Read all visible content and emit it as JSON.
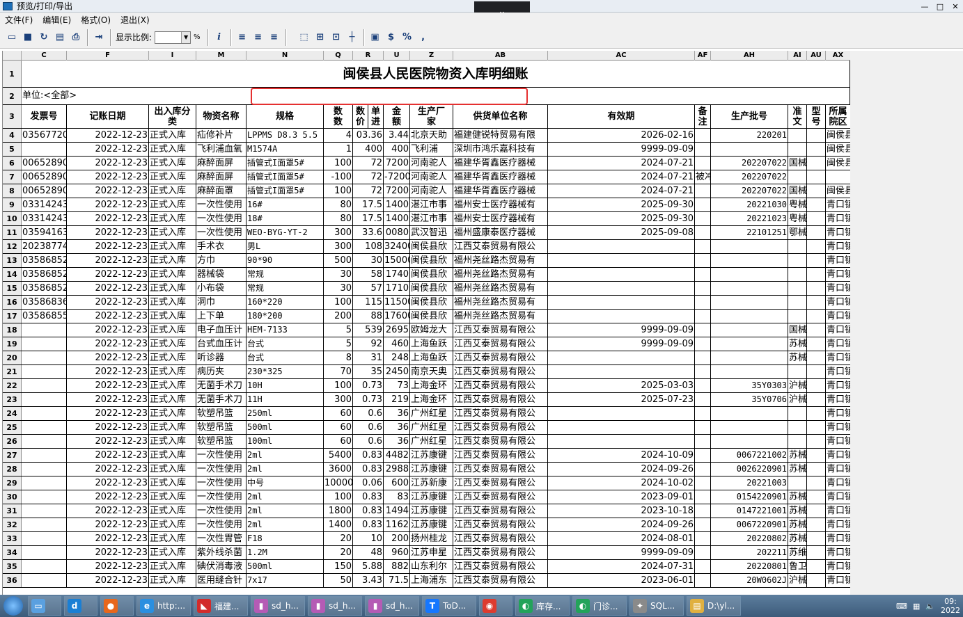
{
  "window": {
    "title": "预览/打印/导出",
    "controls": [
      "—",
      "□",
      "✕"
    ],
    "drop_icon": "chevron-down-icon"
  },
  "menu": [
    "文件(F)",
    "编辑(E)",
    "格式(O)",
    "退出(X)"
  ],
  "toolbar": {
    "zoom_label": "显示比例:",
    "zoom_value": "",
    "zoom_unit": "%",
    "icons": [
      "open-icon",
      "save-icon",
      "refresh-icon",
      "print-preview-icon",
      "print-icon",
      "export-icon",
      "info-icon",
      "align-left-icon",
      "align-center-icon",
      "align-right-icon",
      "grid-a-icon",
      "grid-b-icon",
      "grid-c-icon",
      "grid-d-icon",
      "format-icon",
      "currency-icon",
      "percent-icon",
      "thousands-icon"
    ]
  },
  "sheet": {
    "columns": [
      "C",
      "F",
      "I",
      "M",
      "N",
      "Q",
      "R",
      "U",
      "Z",
      "AB",
      "AC",
      "AF",
      "AH",
      "AI",
      "AU",
      "AX"
    ],
    "title": "闽侯县人民医院物资入库明细账",
    "unit": "单位:<全部>",
    "headers": [
      "发票号",
      "记账日期",
      "出入库分类",
      "物资名称",
      "规格",
      "数量",
      "数价",
      "单进",
      "金额",
      "生产厂家",
      "供货单位名称",
      "有效期",
      "备注",
      "生产批号",
      "准文",
      "型号",
      "所属院区"
    ],
    "header_lines": [
      [
        "发票号"
      ],
      [
        "记账日期"
      ],
      [
        "出入库分",
        "类"
      ],
      [
        "物资名称"
      ],
      [
        "规格"
      ],
      [
        "数",
        "数"
      ],
      [
        "数",
        "价"
      ],
      [
        "单",
        "进"
      ],
      [
        "金",
        "额"
      ],
      [
        "生产厂",
        "家"
      ],
      [
        "供货单位名称"
      ],
      [
        "有效期"
      ],
      [
        "备",
        "注"
      ],
      [
        "生产批号"
      ],
      [
        "准",
        "文"
      ],
      [
        "型",
        "号"
      ],
      [
        "所属",
        "院区"
      ]
    ],
    "rows": [
      [
        "03567720",
        "2022-12-23",
        "正式入库",
        "疝修补片",
        "LPPMS D8.3 5.5",
        "4",
        "03.36",
        "3.44",
        "北京天助",
        "福建健锐特贸易有限",
        "2026-02-16",
        "",
        "220201",
        "",
        "",
        "闽侯县"
      ],
      [
        "",
        "2022-12-23",
        "正式入库",
        "飞利浦血氧",
        "M1574A",
        "1",
        "400",
        "400",
        "飞利浦",
        "深圳市鸿乐嘉科技有",
        "9999-09-09",
        "",
        "",
        "",
        "",
        "闽侯县"
      ],
      [
        "00652890",
        "2022-12-23",
        "正式入库",
        "麻醉面屏",
        "插管式I面罩5#",
        "100",
        "72",
        "7200",
        "河南驼人",
        "福建华胥鑫医疗器械",
        "2024-07-21",
        "",
        "202207022",
        "国械",
        "",
        "闽侯县"
      ],
      [
        "00652890",
        "2022-12-23",
        "正式入库",
        "麻醉面屏",
        "插管式I面罩5#",
        "-100",
        "72",
        "-7200",
        "河南驼人",
        "福建华胥鑫医疗器械",
        "2024-07-21",
        "被冲",
        "202207022",
        "",
        "",
        ""
      ],
      [
        "00652890",
        "2022-12-23",
        "正式入库",
        "麻醉面罩",
        "插管式I面罩5#",
        "100",
        "72",
        "7200",
        "河南驼人",
        "福建华胥鑫医疗器械",
        "2024-07-21",
        "",
        "202207022",
        "国械",
        "",
        "闽侯县"
      ],
      [
        "03314243",
        "2022-12-23",
        "正式入库",
        "一次性使用",
        "16#",
        "80",
        "17.5",
        "1400",
        "湛江市事",
        "福州安士医疗器械有",
        "2025-09-30",
        "",
        "20221030",
        "粤械",
        "",
        "青口镇"
      ],
      [
        "03314243",
        "2022-12-23",
        "正式入库",
        "一次性使用",
        "18#",
        "80",
        "17.5",
        "1400",
        "湛江市事",
        "福州安士医疗器械有",
        "2025-09-30",
        "",
        "20221023",
        "粤械",
        "",
        "青口镇"
      ],
      [
        "03594163",
        "2022-12-23",
        "正式入库",
        "一次性使用",
        "WEO-BYG-YT-2",
        "300",
        "33.6",
        "0080",
        "武汉智迅",
        "福州盛康泰医疗器械",
        "2025-09-08",
        "",
        "22101251",
        "鄂械",
        "",
        "青口镇"
      ],
      [
        "20238774",
        "2022-12-23",
        "正式入库",
        "手术衣",
        "男L",
        "300",
        "108",
        "32400",
        "闽侯县欣",
        "江西艾泰贸易有限公",
        "",
        "",
        "",
        "",
        "",
        "青口镇"
      ],
      [
        "03586852",
        "2022-12-23",
        "正式入库",
        "方巾",
        "90*90",
        "500",
        "30",
        "15000",
        "闽侯县欣",
        "福州尧丝路杰贸易有",
        "",
        "",
        "",
        "",
        "",
        "青口镇"
      ],
      [
        "03586852",
        "2022-12-23",
        "正式入库",
        "器械袋",
        "常规",
        "30",
        "58",
        "1740",
        "闽侯县欣",
        "福州尧丝路杰贸易有",
        "",
        "",
        "",
        "",
        "",
        "青口镇"
      ],
      [
        "03586852",
        "2022-12-23",
        "正式入库",
        "小布袋",
        "常规",
        "30",
        "57",
        "1710",
        "闽侯县欣",
        "福州尧丝路杰贸易有",
        "",
        "",
        "",
        "",
        "",
        "青口镇"
      ],
      [
        "03586836",
        "2022-12-23",
        "正式入库",
        "洞巾",
        "160*220",
        "100",
        "115",
        "11500",
        "闽侯县欣",
        "福州尧丝路杰贸易有",
        "",
        "",
        "",
        "",
        "",
        "青口镇"
      ],
      [
        "03586855",
        "2022-12-23",
        "正式入库",
        "上下单",
        "180*200",
        "200",
        "88",
        "17600",
        "闽侯县欣",
        "福州尧丝路杰贸易有",
        "",
        "",
        "",
        "",
        "",
        "青口镇"
      ],
      [
        "",
        "2022-12-23",
        "正式入库",
        "电子血压计",
        "HEM-7133",
        "5",
        "539",
        "2695",
        "欧姆龙大",
        "江西艾泰贸易有限公",
        "9999-09-09",
        "",
        "",
        "国械",
        "",
        "青口镇"
      ],
      [
        "",
        "2022-12-23",
        "正式入库",
        "台式血压计",
        "台式",
        "5",
        "92",
        "460",
        "上海鱼跃",
        "江西艾泰贸易有限公",
        "9999-09-09",
        "",
        "",
        "苏械",
        "",
        "青口镇"
      ],
      [
        "",
        "2022-12-23",
        "正式入库",
        "听诊器",
        "台式",
        "8",
        "31",
        "248",
        "上海鱼跃",
        "江西艾泰贸易有限公",
        "",
        "",
        "",
        "苏械",
        "",
        "青口镇"
      ],
      [
        "",
        "2022-12-23",
        "正式入库",
        "病历夹",
        "230*325",
        "70",
        "35",
        "2450",
        "南京天奥",
        "江西艾泰贸易有限公",
        "",
        "",
        "",
        "",
        "",
        "青口镇"
      ],
      [
        "",
        "2022-12-23",
        "正式入库",
        "无菌手术刀",
        "10H",
        "100",
        "0.73",
        "73",
        "上海金环",
        "江西艾泰贸易有限公",
        "2025-03-03",
        "",
        "35Y0303",
        "沪械",
        "",
        "青口镇"
      ],
      [
        "",
        "2022-12-23",
        "正式入库",
        "无菌手术刀",
        "11H",
        "300",
        "0.73",
        "219",
        "上海金环",
        "江西艾泰贸易有限公",
        "2025-07-23",
        "",
        "35Y0706",
        "沪械",
        "",
        "青口镇"
      ],
      [
        "",
        "2022-12-23",
        "正式入库",
        "软塑吊篮",
        "250ml",
        "60",
        "0.6",
        "36",
        "广州红星",
        "江西艾泰贸易有限公",
        "",
        "",
        "",
        "",
        "",
        "青口镇"
      ],
      [
        "",
        "2022-12-23",
        "正式入库",
        "软塑吊篮",
        "500ml",
        "60",
        "0.6",
        "36",
        "广州红星",
        "江西艾泰贸易有限公",
        "",
        "",
        "",
        "",
        "",
        "青口镇"
      ],
      [
        "",
        "2022-12-23",
        "正式入库",
        "软塑吊篮",
        "100ml",
        "60",
        "0.6",
        "36",
        "广州红星",
        "江西艾泰贸易有限公",
        "",
        "",
        "",
        "",
        "",
        "青口镇"
      ],
      [
        "",
        "2022-12-23",
        "正式入库",
        "一次性使用",
        "2ml",
        "5400",
        "0.83",
        "4482",
        "江苏康键",
        "江西艾泰贸易有限公",
        "2024-10-09",
        "",
        "0067221002",
        "苏械",
        "",
        "青口镇"
      ],
      [
        "",
        "2022-12-23",
        "正式入库",
        "一次性使用",
        "2ml",
        "3600",
        "0.83",
        "2988",
        "江苏康键",
        "江西艾泰贸易有限公",
        "2024-09-26",
        "",
        "0026220901",
        "苏械",
        "",
        "青口镇"
      ],
      [
        "",
        "2022-12-23",
        "正式入库",
        "一次性使用",
        "中号",
        "10000",
        "0.06",
        "600",
        "江苏新康",
        "江西艾泰贸易有限公",
        "2024-10-02",
        "",
        "20221003",
        "",
        "",
        "青口镇"
      ],
      [
        "",
        "2022-12-23",
        "正式入库",
        "一次性使用",
        "2ml",
        "100",
        "0.83",
        "83",
        "江苏康键",
        "江西艾泰贸易有限公",
        "2023-09-01",
        "",
        "0154220901",
        "苏械",
        "",
        "青口镇"
      ],
      [
        "",
        "2022-12-23",
        "正式入库",
        "一次性使用",
        "2ml",
        "1800",
        "0.83",
        "1494",
        "江苏康键",
        "江西艾泰贸易有限公",
        "2023-10-18",
        "",
        "0147221001",
        "苏械",
        "",
        "青口镇"
      ],
      [
        "",
        "2022-12-23",
        "正式入库",
        "一次性使用",
        "2ml",
        "1400",
        "0.83",
        "1162",
        "江苏康键",
        "江西艾泰贸易有限公",
        "2024-09-26",
        "",
        "0067220901",
        "苏械",
        "",
        "青口镇"
      ],
      [
        "",
        "2022-12-23",
        "正式入库",
        "一次性胃管",
        "F18",
        "20",
        "10",
        "200",
        "扬州桂龙",
        "江西艾泰贸易有限公",
        "2024-08-01",
        "",
        "20220802",
        "苏械",
        "",
        "青口镇"
      ],
      [
        "",
        "2022-12-23",
        "正式入库",
        "紫外线杀菌",
        "1.2M",
        "20",
        "48",
        "960",
        "江苏申星",
        "江西艾泰贸易有限公",
        "9999-09-09",
        "",
        "202211",
        "苏维",
        "",
        "青口镇"
      ],
      [
        "",
        "2022-12-23",
        "正式入库",
        "碘伏消毒液",
        "500ml",
        "150",
        "5.88",
        "882",
        "山东利尔",
        "江西艾泰贸易有限公",
        "2024-07-31",
        "",
        "20220801",
        "鲁卫",
        "",
        "青口镇"
      ],
      [
        "",
        "2022-12-23",
        "正式入库",
        "医用缝合针",
        "7x17",
        "50",
        "3.43",
        "71.5",
        "上海浦东",
        "江西艾泰贸易有限公",
        "2023-06-01",
        "",
        "20W0602J",
        "沪械",
        "",
        "青口镇"
      ]
    ]
  },
  "taskbar": [
    {
      "label": "",
      "icon": "desktop-icon"
    },
    {
      "label": "",
      "icon": "app-d-icon"
    },
    {
      "label": "",
      "icon": "firefox-icon"
    },
    {
      "label": "http:...",
      "icon": "ie-icon"
    },
    {
      "label": "福建...",
      "icon": "app-red-icon"
    },
    {
      "label": "sd_h...",
      "icon": "database-icon"
    },
    {
      "label": "sd_h...",
      "icon": "database-icon"
    },
    {
      "label": "sd_h...",
      "icon": "database-icon"
    },
    {
      "label": "ToD...",
      "icon": "todesk-icon"
    },
    {
      "label": "",
      "icon": "chrome-icon"
    },
    {
      "label": "库存...",
      "icon": "app-green-icon"
    },
    {
      "label": "门诊...",
      "icon": "app-green-icon"
    },
    {
      "label": "SQL...",
      "icon": "sql-icon"
    },
    {
      "label": "D:\\yl...",
      "icon": "folder-icon"
    }
  ],
  "tray": {
    "time": "09:",
    "date": "2022"
  }
}
